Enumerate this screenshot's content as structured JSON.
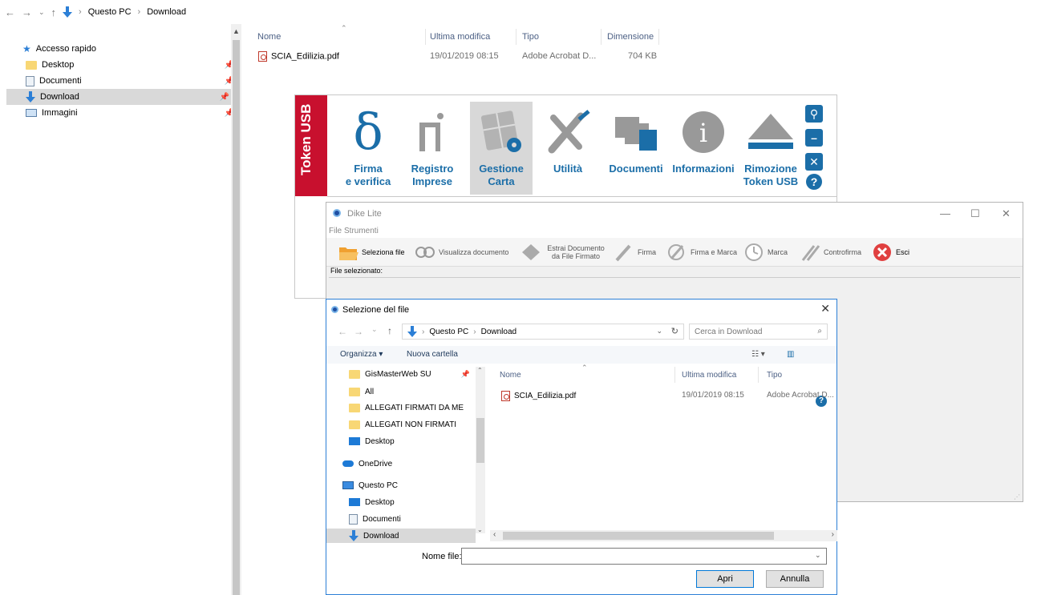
{
  "explorer": {
    "breadcrumb": [
      "Questo PC",
      "Download"
    ],
    "sidebar": [
      {
        "label": "Accesso rapido",
        "icon": "star-icon"
      },
      {
        "label": "Desktop",
        "icon": "folder-icon"
      },
      {
        "label": "Documenti",
        "icon": "documents-icon"
      },
      {
        "label": "Download",
        "icon": "download-icon"
      },
      {
        "label": "Immagini",
        "icon": "pictures-icon"
      }
    ],
    "columns": [
      "Nome",
      "Ultima modifica",
      "Tipo",
      "Dimensione"
    ],
    "files": [
      {
        "name": "SCIA_Edilizia.pdf",
        "modified": "19/01/2019 08:15",
        "type": "Adobe Acrobat D...",
        "size": "704 KB"
      }
    ]
  },
  "token_toolbar": {
    "band_label": "Token USB",
    "buttons": [
      {
        "label1": "Firma",
        "label2": "e verifica",
        "icon": "delta-icon"
      },
      {
        "label1": "Registro",
        "label2": "Imprese",
        "icon": "registry-icon"
      },
      {
        "label1": "Gestione",
        "label2": "Carta",
        "icon": "card-gear-icon"
      },
      {
        "label1": "Utilità",
        "label2": "",
        "icon": "tools-icon"
      },
      {
        "label1": "Documenti",
        "label2": "",
        "icon": "documents-icon"
      },
      {
        "label1": "Informazioni",
        "label2": "",
        "icon": "info-icon"
      },
      {
        "label1": "Rimozione",
        "label2": "Token USB",
        "icon": "eject-icon"
      }
    ]
  },
  "dike": {
    "title": "Dike Lite",
    "menu": [
      "File",
      "Strumenti"
    ],
    "tools": [
      {
        "label": "Seleziona file"
      },
      {
        "label": "Visualizza documento"
      },
      {
        "label": "Estrai Documento da File Firmato"
      },
      {
        "label": "Firma"
      },
      {
        "label": "Firma e Marca"
      },
      {
        "label": "Marca"
      },
      {
        "label": "Controfirma"
      },
      {
        "label": "Esci"
      }
    ],
    "selected_label": "File selezionato:"
  },
  "dialog": {
    "title": "Selezione del file",
    "breadcrumb": [
      "Questo PC",
      "Download"
    ],
    "search_placeholder": "Cerca in Download",
    "organize": "Organizza ▾",
    "new_folder": "Nuova cartella",
    "nav": [
      {
        "label": "GisMasterWeb SU",
        "icon": "folder-icon"
      },
      {
        "label": "All",
        "icon": "folder-icon"
      },
      {
        "label": "ALLEGATI FIRMATI DA ME",
        "icon": "folder-icon"
      },
      {
        "label": "ALLEGATI NON FIRMATI",
        "icon": "folder-icon"
      },
      {
        "label": "Desktop",
        "icon": "desktop-icon"
      },
      {
        "label": "OneDrive",
        "icon": "cloud-icon"
      },
      {
        "label": "Questo PC",
        "icon": "pc-icon"
      },
      {
        "label": "Desktop",
        "icon": "desktop-icon"
      },
      {
        "label": "Documenti",
        "icon": "documents-icon"
      },
      {
        "label": "Download",
        "icon": "download-icon"
      }
    ],
    "columns": [
      "Nome",
      "Ultima modifica",
      "Tipo"
    ],
    "files": [
      {
        "name": "SCIA_Edilizia.pdf",
        "modified": "19/01/2019 08:15",
        "type": "Adobe Acrobat D..."
      }
    ],
    "filename_label": "Nome file:",
    "filename_value": "",
    "open_label": "Apri",
    "cancel_label": "Annulla"
  }
}
